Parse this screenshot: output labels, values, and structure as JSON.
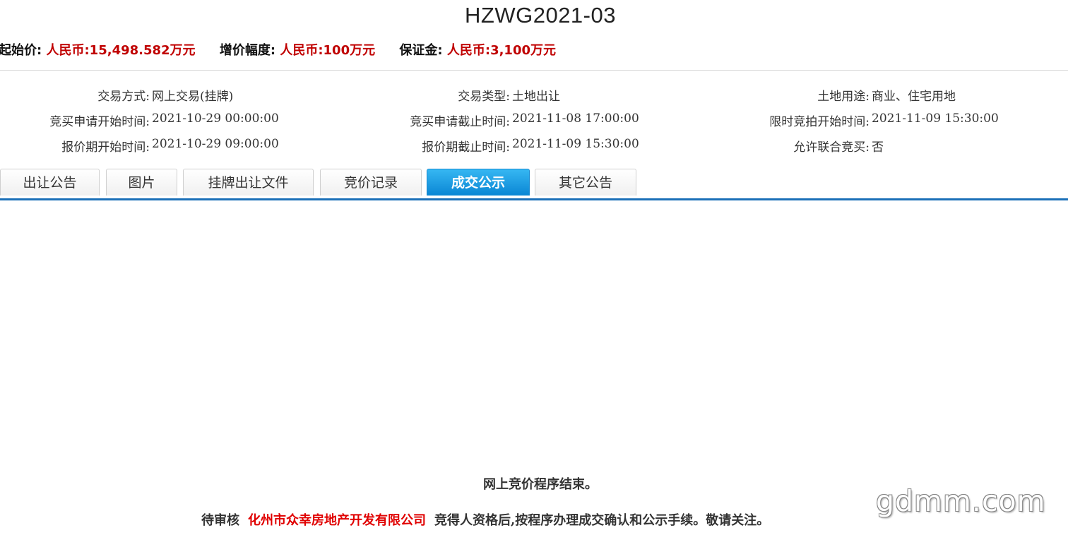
{
  "page": {
    "title": "HZWG2021-03"
  },
  "prices": {
    "start_label": "起始价:",
    "start_value": "人民币:15,498.582万元",
    "increment_label": "增价幅度:",
    "increment_value": "人民币:100万元",
    "deposit_label": "保证金:",
    "deposit_value": "人民币:3,100万元"
  },
  "info": {
    "rows": [
      [
        {
          "key": "交易方式:",
          "value": "网上交易(挂牌)"
        },
        {
          "key": "交易类型:",
          "value": "土地出让"
        },
        {
          "key": "土地用途:",
          "value": "商业、住宅用地"
        }
      ],
      [
        {
          "key": "竞买申请开始时间:",
          "value": "2021-10-29 00:00:00"
        },
        {
          "key": "竞买申请截止时间:",
          "value": "2021-11-08 17:00:00"
        },
        {
          "key": "限时竞拍开始时间:",
          "value": "2021-11-09 15:30:00"
        }
      ],
      [
        {
          "key": "报价期开始时间:",
          "value": "2021-10-29 09:00:00"
        },
        {
          "key": "报价期截止时间:",
          "value": "2021-11-09 15:30:00"
        },
        {
          "key": "允许联合竞买:",
          "value": "否"
        }
      ]
    ]
  },
  "tabs": [
    {
      "label": "出让公告",
      "active": false
    },
    {
      "label": "图片",
      "active": false
    },
    {
      "label": "挂牌出让文件",
      "active": false
    },
    {
      "label": "竞价记录",
      "active": false
    },
    {
      "label": "成交公示",
      "active": true
    },
    {
      "label": "其它公告",
      "active": false
    }
  ],
  "notice": {
    "line1": "网上竞价程序结束。",
    "line2_prefix": "待审核",
    "line2_company": "化州市众幸房地产开发有限公司",
    "line2_suffix": "竞得人资格后,按程序办理成交确认和公示手续。敬请关注。"
  },
  "watermark": "gdmm.com",
  "colors": {
    "price_value": "#c00000",
    "tab_active": "#0a86d4",
    "tab_underline": "#1a6fb8",
    "company": "#e00000"
  }
}
